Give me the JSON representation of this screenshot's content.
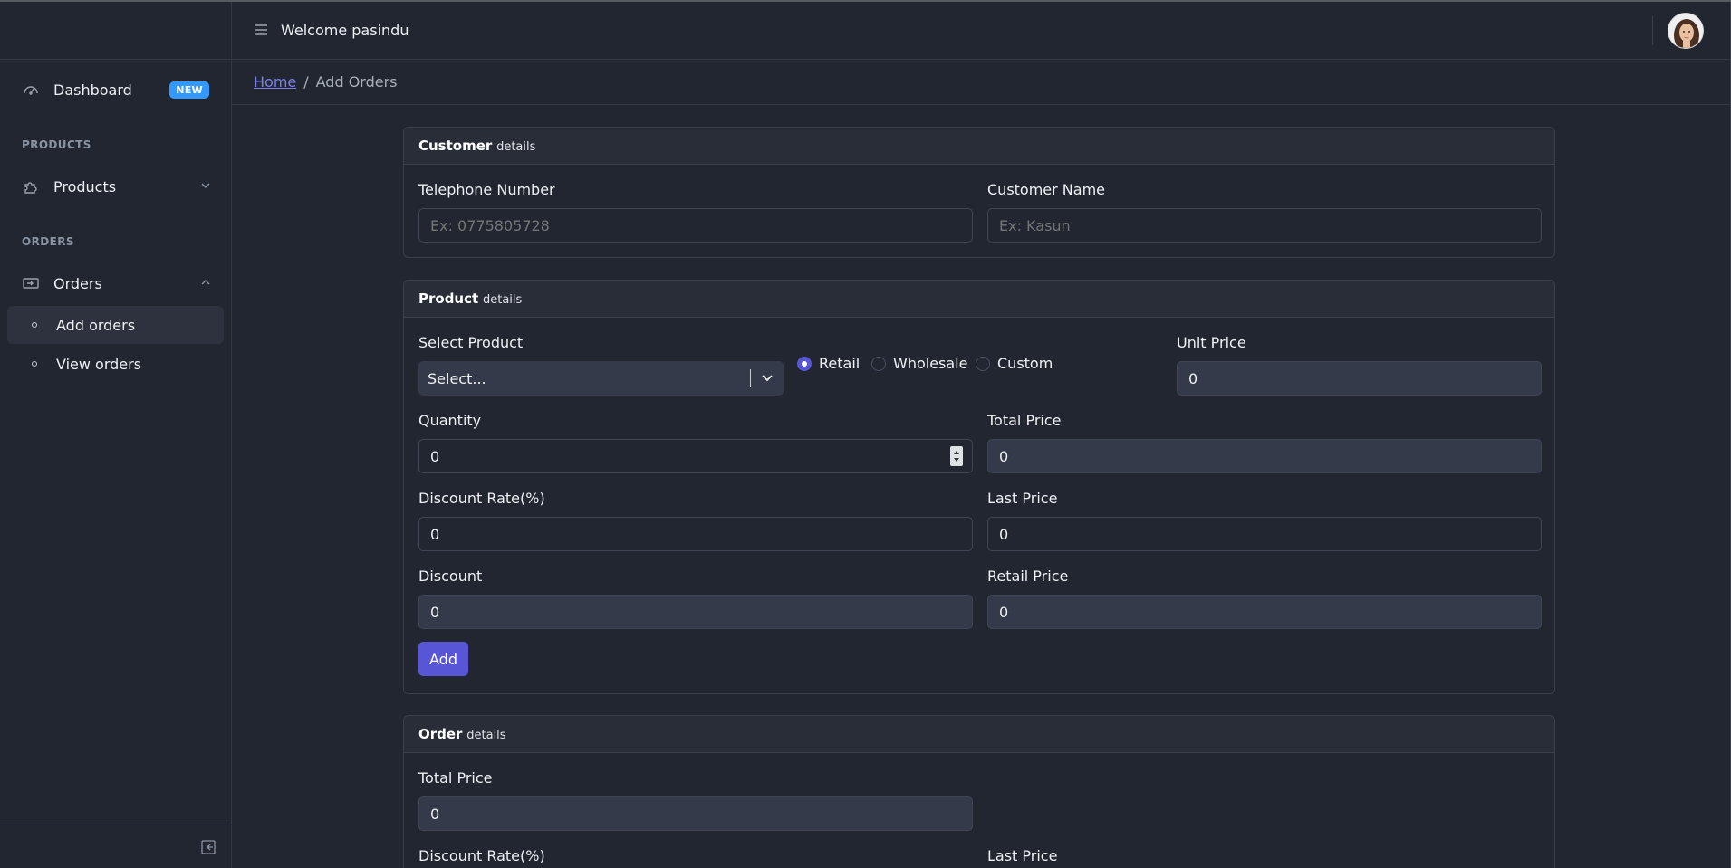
{
  "header": {
    "welcome": "Welcome pasindu"
  },
  "sidebar": {
    "dashboard_label": "Dashboard",
    "dashboard_badge": "NEW",
    "products_section": "PRODUCTS",
    "products_label": "Products",
    "orders_section": "ORDERS",
    "orders_label": "Orders",
    "sub_items": [
      "Add orders",
      "View orders"
    ]
  },
  "breadcrumb": {
    "home": "Home",
    "separator": "/",
    "current": "Add Orders"
  },
  "customer": {
    "title_bold": "Customer",
    "title_rest": "details",
    "telephone_label": "Telephone Number",
    "telephone_placeholder": "Ex: 0775805728",
    "name_label": "Customer Name",
    "name_placeholder": "Ex: Kasun"
  },
  "product": {
    "title_bold": "Product",
    "title_rest": "details",
    "select_label": "Select Product",
    "select_value": "Select...",
    "price_types": [
      "Retail",
      "Wholesale",
      "Custom"
    ],
    "price_type_selected": "Retail",
    "unit_price_label": "Unit Price",
    "unit_price": "0",
    "quantity_label": "Quantity",
    "quantity": "0",
    "total_price_label": "Total Price",
    "total_price": "0",
    "discount_rate_label": "Discount Rate(%)",
    "discount_rate": "0",
    "last_price_label": "Last Price",
    "last_price": "0",
    "discount_label": "Discount",
    "discount": "0",
    "retail_price_label": "Retail Price",
    "retail_price": "0",
    "add_button": "Add"
  },
  "order": {
    "title_bold": "Order",
    "title_rest": "details",
    "total_price_label": "Total Price",
    "total_price": "0",
    "discount_rate_label": "Discount Rate(%)",
    "last_price_label": "Last Price"
  },
  "colors": {
    "background": "#212631",
    "accent": "#5856d6",
    "badge": "#3399ff"
  }
}
